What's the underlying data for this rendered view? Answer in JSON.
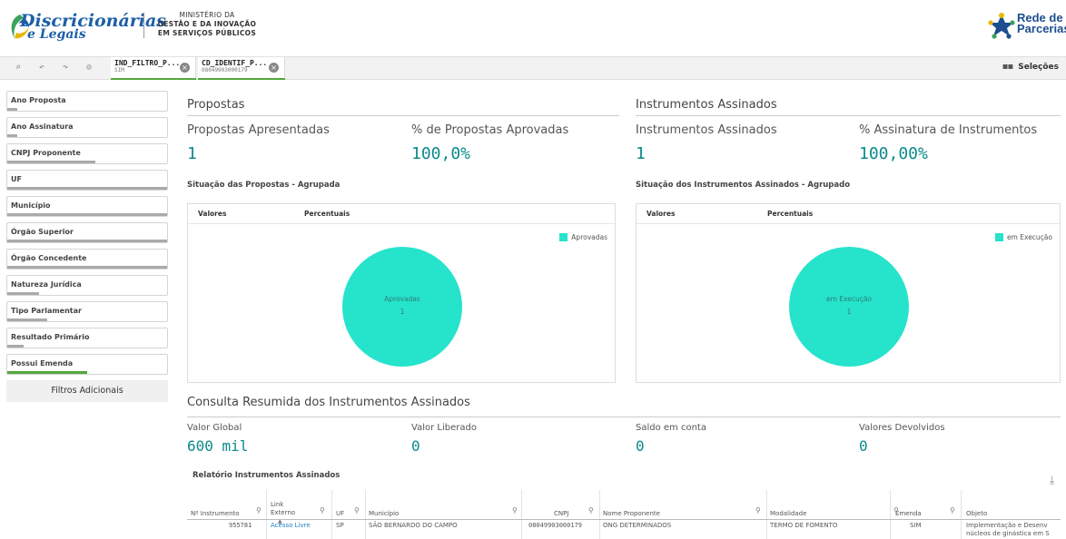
{
  "header": {
    "logo_line1": "Discricionárias",
    "logo_line2": "e Legais",
    "ministry_line1": "MINISTÉRIO DA",
    "ministry_line2": "GESTÃO E DA INOVAÇÃO",
    "ministry_line3": "EM SERVIÇOS PÚBLICOS",
    "partner_line1": "Rede de",
    "partner_line2": "Parcerias"
  },
  "selection_bar": {
    "chips": [
      {
        "name": "IND_FILTRO_P...",
        "value": "SIM"
      },
      {
        "name": "CD_IDENTIF_P...",
        "value": "08049903000179"
      }
    ],
    "selections_label": "Seleções"
  },
  "filters": {
    "items": [
      {
        "label": "Ano Proposta",
        "fill": 0.06,
        "style": "grey"
      },
      {
        "label": "Ano Assinatura",
        "fill": 0.06,
        "style": "grey"
      },
      {
        "label": "CNPJ Proponente",
        "fill": 0.55,
        "style": "grey"
      },
      {
        "label": "UF",
        "fill": 1.0,
        "style": "grey"
      },
      {
        "label": "Município",
        "fill": 1.0,
        "style": "grey"
      },
      {
        "label": "Órgão Superior",
        "fill": 1.0,
        "style": "grey"
      },
      {
        "label": "Órgão Concedente",
        "fill": 1.0,
        "style": "grey"
      },
      {
        "label": "Natureza Jurídica",
        "fill": 0.2,
        "style": "grey"
      },
      {
        "label": "Tipo Parlamentar",
        "fill": 0.25,
        "style": "grey"
      },
      {
        "label": "Resultado Primário",
        "fill": 0.1,
        "style": "grey"
      },
      {
        "label": "Possui Emenda",
        "fill": 0.5,
        "style": "green"
      }
    ],
    "additional_label": "Filtros Adicionais"
  },
  "propostas": {
    "section_title": "Propostas",
    "kpi1_label": "Propostas Apresentadas",
    "kpi1_value": "1",
    "kpi2_label": "% de Propostas Aprovadas",
    "kpi2_value": "100,0%",
    "chart_title": "Situação das Propostas - Agrupada",
    "tab1": "Valores",
    "tab2": "Percentuais"
  },
  "instrumentos": {
    "section_title": "Instrumentos Assinados",
    "kpi1_label": "Instrumentos Assinados",
    "kpi1_value": "1",
    "kpi2_label": "% Assinatura de Instrumentos",
    "kpi2_value": "100,00%",
    "chart_title": "Situação dos Instrumentos Assinados - Agrupado",
    "tab1": "Valores",
    "tab2": "Percentuais"
  },
  "chart_data": [
    {
      "type": "pie",
      "categories": [
        "Aprovadas"
      ],
      "values": [
        1
      ],
      "legend": [
        "Aprovadas"
      ],
      "legend_position": "top-right",
      "colors": [
        "#26e3cc"
      ]
    },
    {
      "type": "pie",
      "categories": [
        "em Execução"
      ],
      "values": [
        1
      ],
      "legend": [
        "em Execução"
      ],
      "legend_position": "top-right",
      "colors": [
        "#26e3cc"
      ]
    }
  ],
  "consulta": {
    "section_title": "Consulta Resumida dos Instrumentos Assinados",
    "kpis": [
      {
        "label": "Valor Global",
        "value": "600 mil"
      },
      {
        "label": "Valor Liberado",
        "value": "0"
      },
      {
        "label": "Saldo em conta",
        "value": "0"
      },
      {
        "label": "Valores Devolvidos",
        "value": "0"
      }
    ],
    "report_title": "Relatório Instrumentos Assinados"
  },
  "table": {
    "headers": [
      "Nº Instrumento",
      "Link Externo",
      "UF",
      "Município",
      "CNPJ",
      "Nome Proponente",
      "Modalidade",
      "Emenda",
      "Objeto"
    ],
    "rows": [
      {
        "numero": "955781",
        "link": "Acesso Livre",
        "uf": "SP",
        "municipio": "SÃO BERNARDO DO CAMPO",
        "cnpj": "08049903000179",
        "nome": "ONG DETERMINADOS",
        "modalidade": "TERMO DE FOMENTO",
        "emenda": "SIM",
        "objeto1": "Implementação e Desenv",
        "objeto2": "núcleos de ginástica em S"
      }
    ]
  },
  "colors": {
    "accent": "#0b8a8a",
    "pie": "#26e3cc",
    "selected": "#52a73e",
    "brand": "#1d5fa6"
  }
}
